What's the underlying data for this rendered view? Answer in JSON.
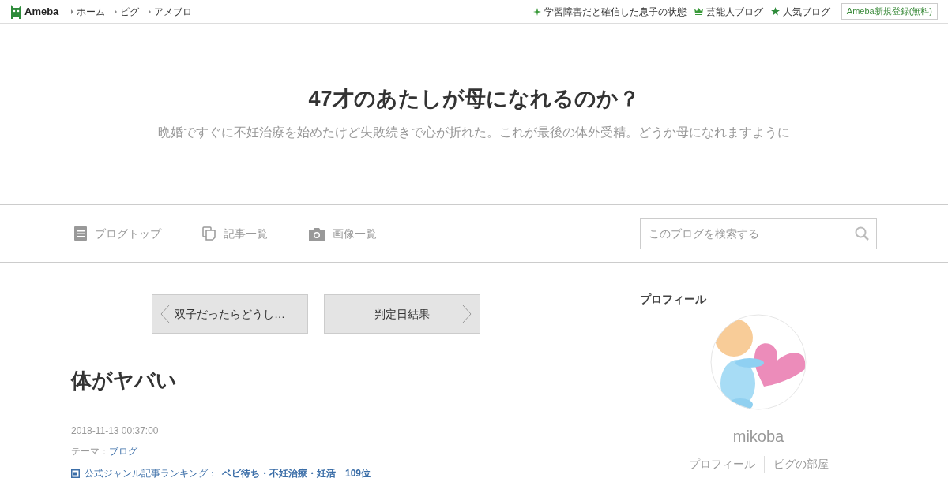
{
  "header": {
    "logo": "Ameba",
    "nav_links": [
      "ホーム",
      "ピグ",
      "アメブロ"
    ],
    "right_links": [
      {
        "kind": "sparkle",
        "label": "学習障害だと確信した息子の状態"
      },
      {
        "kind": "crown",
        "label": "芸能人ブログ"
      },
      {
        "kind": "star",
        "label": "人気ブログ"
      }
    ],
    "register_button": "Ameba新規登録(無料)"
  },
  "blog": {
    "title": "47才のあたしが母になれるのか？",
    "description": "晩婚ですぐに不妊治療を始めたけど失敗続きで心が折れた。これが最後の体外受精。どうか母になれますように"
  },
  "blog_nav": {
    "items": [
      {
        "kind": "document",
        "label": "ブログトップ"
      },
      {
        "kind": "pages",
        "label": "記事一覧"
      },
      {
        "kind": "camera",
        "label": "画像一覧"
      }
    ],
    "search": {
      "placeholder": "このブログを検索する"
    }
  },
  "article": {
    "prev": "双子だったらどうし…",
    "next": "判定日結果",
    "title": "体がヤバい",
    "date": "2018-11-13 00:37:00",
    "theme_label": "テーマ：",
    "theme": "ブログ",
    "ranking_label": "公式ジャンル記事ランキング：",
    "ranking_genre": "ベビ待ち・不妊治療・妊活",
    "ranking_rank": "109位"
  },
  "sidebar": {
    "heading": "プロフィール",
    "username": "mikoba",
    "links": [
      "プロフィール",
      "ピグの部屋"
    ]
  }
}
